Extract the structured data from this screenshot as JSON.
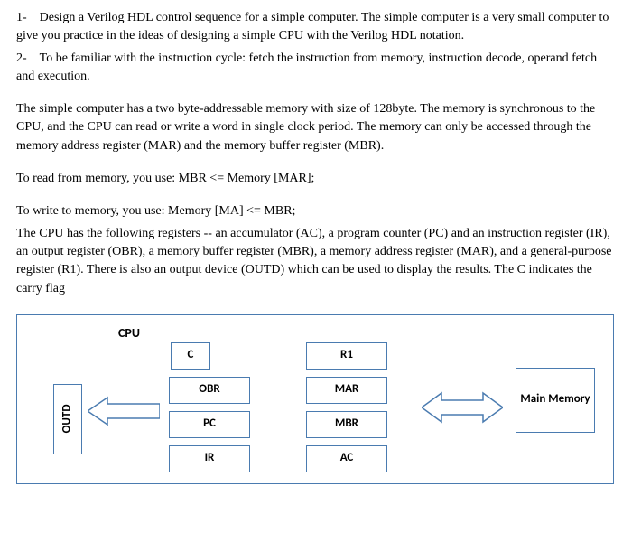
{
  "text": {
    "p1": "1-    Design a Verilog HDL control sequence for a simple computer. The simple computer is a very small computer to give you practice in the ideas of designing a simple CPU with the Verilog HDL notation.",
    "p2": "2-    To be familiar with the instruction cycle: fetch the instruction from memory, instruction decode, operand fetch and execution.",
    "p3": "The simple computer has a two byte-addressable memory with size of 128byte. The memory is synchronous to the CPU, and the CPU can read or write a word in single clock period. The memory can only be accessed through the memory address register (MAR) and the memory buffer register (MBR).",
    "p4": "To read from memory, you use: MBR <= Memory [MAR];",
    "p5": "To write to memory, you use: Memory [MA] <= MBR;",
    "p6": "The CPU has the following registers -- an accumulator (AC), a program counter (PC) and an instruction register (IR), an output register (OBR), a memory buffer register (MBR), a memory address register (MAR), and a general-purpose register (R1). There is also an output device (OUTD) which can be used to display the results. The C indicates the carry flag"
  },
  "diagram": {
    "cpu": "CPU",
    "outd": "OUTD",
    "c": "C",
    "obr": "OBR",
    "pc": "PC",
    "ir": "IR",
    "r1": "R1",
    "mar": "MAR",
    "mbr": "MBR",
    "ac": "AC",
    "mem": "Main Memory"
  }
}
